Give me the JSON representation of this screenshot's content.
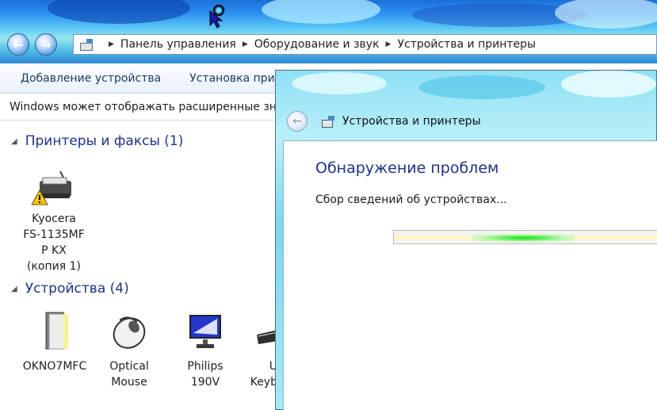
{
  "window": {
    "breadcrumbs": [
      "Панель управления",
      "Оборудование и звук",
      "Устройства и принтеры"
    ]
  },
  "toolbar": {
    "add_device": "Добавление устройства",
    "install_printer": "Установка принте"
  },
  "infobar": {
    "text": "Windows может отображать расширенные знач"
  },
  "groups": {
    "printers": {
      "title": "Принтеры и факсы (1)"
    },
    "devices": {
      "title": "Устройства (4)"
    }
  },
  "printers": [
    {
      "label": "Kyocera\nFS-1135MF\nP KX\n(копия 1)",
      "icon": "printer-warning-icon"
    }
  ],
  "devices": [
    {
      "label": "OKNO7MFC",
      "icon": "computer-tower-icon"
    },
    {
      "label": "Optical\nMouse",
      "icon": "mouse-icon"
    },
    {
      "label": "Philips\n190V",
      "icon": "monitor-icon"
    },
    {
      "label": "U\nKeyb",
      "icon": "keyboard-icon"
    }
  ],
  "dialog": {
    "window_title": "Устройства и принтеры",
    "heading": "Обнаружение проблем",
    "status": "Сбор сведений об устройствах...",
    "progress_state": "indeterminate"
  },
  "colors": {
    "heading_blue": "#1e3287",
    "progress_green": "#16e01a"
  }
}
